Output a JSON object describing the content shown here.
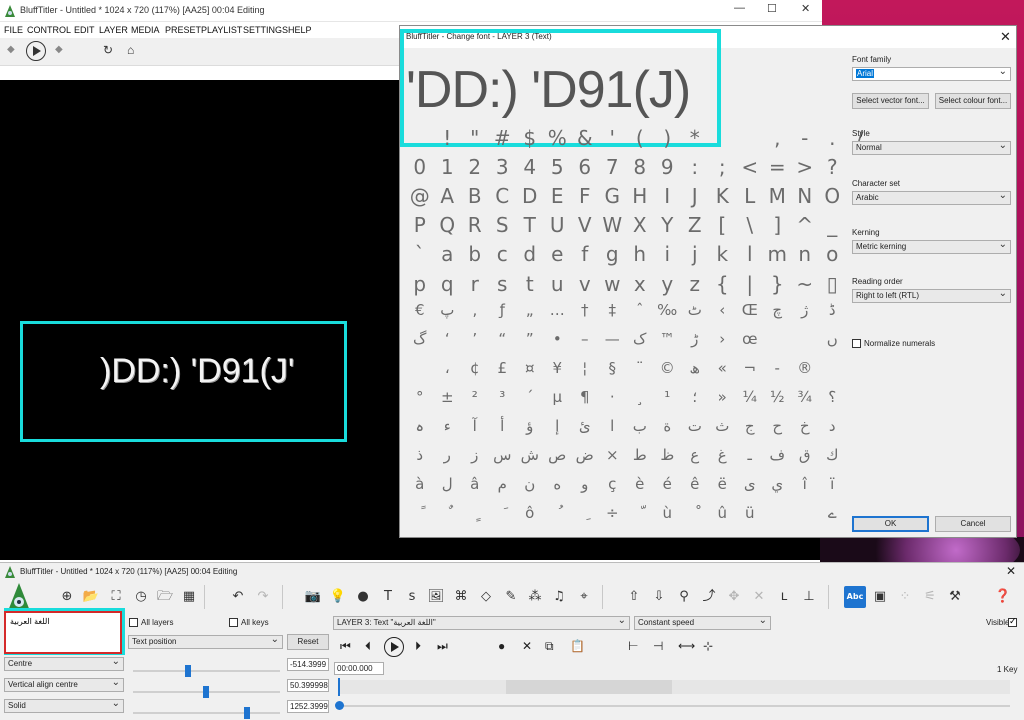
{
  "main_window": {
    "title": "BluffTitler - Untitled * 1024 x 720 (117%) [AA25] 00:04 Editing",
    "menu": [
      "FILE",
      "CONTROL",
      "EDIT",
      "LAYER",
      "MEDIA",
      "PRESET",
      "PLAYLIST",
      "SETTINGS",
      "HELP"
    ],
    "preview_text": ")DD:) 'D91(J'"
  },
  "dialog": {
    "title": "BluffTitler - Change font - LAYER 3 (Text)",
    "sample_text": "'DD:) 'D91(J)",
    "charmap_rows": [
      [
        "",
        "!",
        "\"",
        "#",
        "$",
        "%",
        "&",
        "'",
        "(",
        ")",
        "*",
        "",
        "",
        ",",
        "-",
        ".",
        "/"
      ],
      [
        "0",
        "1",
        "2",
        "3",
        "4",
        "5",
        "6",
        "7",
        "8",
        "9",
        ":",
        ";",
        "<",
        "=",
        ">",
        "?"
      ],
      [
        "@",
        "A",
        "B",
        "C",
        "D",
        "E",
        "F",
        "G",
        "H",
        "I",
        "J",
        "K",
        "L",
        "M",
        "N",
        "O"
      ],
      [
        "P",
        "Q",
        "R",
        "S",
        "T",
        "U",
        "V",
        "W",
        "X",
        "Y",
        "Z",
        "[",
        "\\",
        "]",
        "^",
        "_"
      ],
      [
        "`",
        "a",
        "b",
        "c",
        "d",
        "e",
        "f",
        "g",
        "h",
        "i",
        "j",
        "k",
        "l",
        "m",
        "n",
        "o"
      ],
      [
        "p",
        "q",
        "r",
        "s",
        "t",
        "u",
        "v",
        "w",
        "x",
        "y",
        "z",
        "{",
        "|",
        "}",
        "~",
        "▯"
      ],
      [
        "€",
        "پ",
        "‚",
        "ƒ",
        "„",
        "…",
        "†",
        "‡",
        "ˆ",
        "‰",
        "ٹ",
        "‹",
        "Œ",
        "چ",
        "ژ",
        "ڈ"
      ],
      [
        "گ",
        "‘",
        "’",
        "“",
        "”",
        "•",
        "–",
        "—",
        "ک",
        "™",
        "ڑ",
        "›",
        "œ",
        "",
        "",
        "ں"
      ],
      [
        "",
        "،",
        "¢",
        "£",
        "¤",
        "¥",
        "¦",
        "§",
        "¨",
        "©",
        "ھ",
        "«",
        "¬",
        "-",
        "®",
        ""
      ],
      [
        "°",
        "±",
        "²",
        "³",
        "´",
        "µ",
        "¶",
        "·",
        "¸",
        "¹",
        "؛",
        "»",
        "¼",
        "½",
        "¾",
        "؟"
      ],
      [
        "ہ",
        "ء",
        "آ",
        "أ",
        "ؤ",
        "إ",
        "ئ",
        "ا",
        "ب",
        "ة",
        "ت",
        "ث",
        "ج",
        "ح",
        "خ",
        "د"
      ],
      [
        "ذ",
        "ر",
        "ز",
        "س",
        "ش",
        "ص",
        "ض",
        "×",
        "ط",
        "ظ",
        "ع",
        "غ",
        "ـ",
        "ف",
        "ق",
        "ك"
      ],
      [
        "à",
        "ل",
        "â",
        "م",
        "ن",
        "ه",
        "و",
        "ç",
        "è",
        "é",
        "ê",
        "ë",
        "ى",
        "ي",
        "î",
        "ï"
      ],
      [
        "ً",
        "ٌ",
        "ٍ",
        "َ",
        "ô",
        "ُ",
        "ِ",
        "÷",
        "ّ",
        "ù",
        "ْ",
        "û",
        "ü",
        "",
        "",
        "ے"
      ]
    ],
    "font_family_label": "Font family",
    "font_family_value": "Arial",
    "select_vector_font": "Select vector font...",
    "select_colour_font": "Select colour font...",
    "style_label": "Style",
    "style_value": "Normal",
    "charset_label": "Character set",
    "charset_value": "Arabic",
    "kerning_label": "Kerning",
    "kerning_value": "Metric kerning",
    "reading_order_label": "Reading order",
    "reading_order_value": "Right to left (RTL)",
    "normalize_label": "Normalize numerals",
    "ok_label": "OK",
    "cancel_label": "Cancel"
  },
  "editor": {
    "title": "BluffTitler - Untitled * 1024 x 720 (117%) [AA25] 00:04 Editing",
    "text_content": "اللغة العربية",
    "all_layers": "All layers",
    "all_keys": "All keys",
    "property": "Text position",
    "reset_label": "Reset",
    "anchor_h": "Centre",
    "anchor_v": "Vertical align centre",
    "render_mode": "Solid",
    "value_1": "-514.3999",
    "value_2": "50.399998",
    "value_3": "1252.3999",
    "layer_select": "LAYER 3: Text \"اللغة العربية\"",
    "speed_select": "Constant speed",
    "visible_label": "Visible",
    "time_value": "00:00.000",
    "keys_count": "1 Key"
  },
  "colors": {
    "highlight": "#19dcdc",
    "text_box_border": "#d42a2a",
    "accent": "#1e74d0"
  }
}
